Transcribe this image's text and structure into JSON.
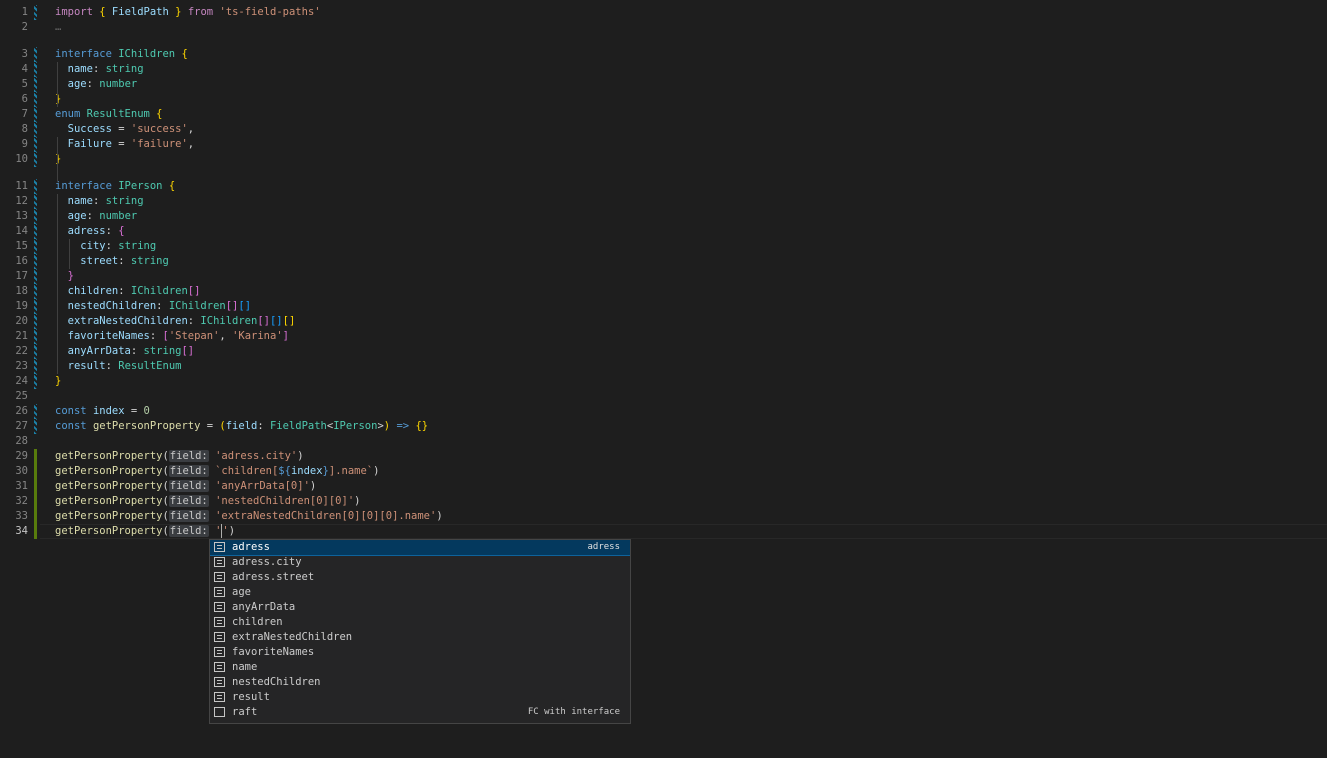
{
  "editor": {
    "active_line": "34",
    "lines": [
      {
        "n": "1",
        "segments": [
          [
            "kw2",
            "import"
          ],
          [
            "pu",
            " "
          ],
          [
            "br1",
            "{"
          ],
          [
            "pu",
            " "
          ],
          [
            "prop",
            "FieldPath"
          ],
          [
            "pu",
            " "
          ],
          [
            "br1",
            "}"
          ],
          [
            "pu",
            " "
          ],
          [
            "kw2",
            "from"
          ],
          [
            "pu",
            " "
          ],
          [
            "str",
            "'ts-field-paths'"
          ]
        ]
      },
      {
        "n": "2",
        "segments": [
          [
            "fold-dots",
            "…"
          ]
        ]
      },
      {
        "n": "3",
        "segments": [
          [
            "kw",
            "interface"
          ],
          [
            "pu",
            " "
          ],
          [
            "ty",
            "IChildren"
          ],
          [
            "pu",
            " "
          ],
          [
            "br1",
            "{"
          ]
        ]
      },
      {
        "n": "4",
        "segments": [
          [
            "pu",
            "  "
          ],
          [
            "prop",
            "name"
          ],
          [
            "pu",
            ": "
          ],
          [
            "ty",
            "string"
          ]
        ]
      },
      {
        "n": "5",
        "segments": [
          [
            "pu",
            "  "
          ],
          [
            "prop",
            "age"
          ],
          [
            "pu",
            ": "
          ],
          [
            "ty",
            "number"
          ]
        ]
      },
      {
        "n": "6",
        "segments": [
          [
            "br1",
            "}"
          ]
        ]
      },
      {
        "n": "7",
        "segments": [
          [
            "kw",
            "enum"
          ],
          [
            "pu",
            " "
          ],
          [
            "ty",
            "ResultEnum"
          ],
          [
            "pu",
            " "
          ],
          [
            "br1",
            "{"
          ]
        ]
      },
      {
        "n": "8",
        "segments": [
          [
            "pu",
            "  "
          ],
          [
            "prop",
            "Success"
          ],
          [
            "pu",
            " = "
          ],
          [
            "str",
            "'success'"
          ],
          [
            "pu",
            ","
          ]
        ]
      },
      {
        "n": "9",
        "segments": [
          [
            "pu",
            "  "
          ],
          [
            "prop",
            "Failure"
          ],
          [
            "pu",
            " = "
          ],
          [
            "str",
            "'failure'"
          ],
          [
            "pu",
            ","
          ]
        ]
      },
      {
        "n": "10",
        "segments": [
          [
            "br1",
            "}"
          ]
        ]
      },
      {
        "n": "11",
        "segments": [
          [
            "kw",
            "interface"
          ],
          [
            "pu",
            " "
          ],
          [
            "ty",
            "IPerson"
          ],
          [
            "pu",
            " "
          ],
          [
            "br1",
            "{"
          ]
        ]
      },
      {
        "n": "12",
        "segments": [
          [
            "pu",
            "  "
          ],
          [
            "prop",
            "name"
          ],
          [
            "pu",
            ": "
          ],
          [
            "ty",
            "string"
          ]
        ]
      },
      {
        "n": "13",
        "segments": [
          [
            "pu",
            "  "
          ],
          [
            "prop",
            "age"
          ],
          [
            "pu",
            ": "
          ],
          [
            "ty",
            "number"
          ]
        ]
      },
      {
        "n": "14",
        "segments": [
          [
            "pu",
            "  "
          ],
          [
            "prop",
            "adress"
          ],
          [
            "pu",
            ": "
          ],
          [
            "br2",
            "{"
          ]
        ]
      },
      {
        "n": "15",
        "segments": [
          [
            "pu",
            "    "
          ],
          [
            "prop",
            "city"
          ],
          [
            "pu",
            ": "
          ],
          [
            "ty",
            "string"
          ]
        ]
      },
      {
        "n": "16",
        "segments": [
          [
            "pu",
            "    "
          ],
          [
            "prop",
            "street"
          ],
          [
            "pu",
            ": "
          ],
          [
            "ty",
            "string"
          ]
        ]
      },
      {
        "n": "17",
        "segments": [
          [
            "pu",
            "  "
          ],
          [
            "br2",
            "}"
          ]
        ]
      },
      {
        "n": "18",
        "segments": [
          [
            "pu",
            "  "
          ],
          [
            "prop",
            "children"
          ],
          [
            "pu",
            ": "
          ],
          [
            "ty",
            "IChildren"
          ],
          [
            "br2",
            "[]"
          ]
        ]
      },
      {
        "n": "19",
        "segments": [
          [
            "pu",
            "  "
          ],
          [
            "prop",
            "nestedChildren"
          ],
          [
            "pu",
            ": "
          ],
          [
            "ty",
            "IChildren"
          ],
          [
            "br2",
            "[]"
          ],
          [
            "br3",
            "[]"
          ]
        ]
      },
      {
        "n": "20",
        "segments": [
          [
            "pu",
            "  "
          ],
          [
            "prop",
            "extraNestedChildren"
          ],
          [
            "pu",
            ": "
          ],
          [
            "ty",
            "IChildren"
          ],
          [
            "br2",
            "[]"
          ],
          [
            "br3",
            "[]"
          ],
          [
            "br1",
            "[]"
          ]
        ]
      },
      {
        "n": "21",
        "segments": [
          [
            "pu",
            "  "
          ],
          [
            "prop",
            "favoriteNames"
          ],
          [
            "pu",
            ": "
          ],
          [
            "br2",
            "["
          ],
          [
            "str",
            "'Stepan'"
          ],
          [
            "pu",
            ", "
          ],
          [
            "str",
            "'Karina'"
          ],
          [
            "br2",
            "]"
          ]
        ]
      },
      {
        "n": "22",
        "segments": [
          [
            "pu",
            "  "
          ],
          [
            "prop",
            "anyArrData"
          ],
          [
            "pu",
            ": "
          ],
          [
            "ty",
            "string"
          ],
          [
            "br2",
            "[]"
          ]
        ]
      },
      {
        "n": "23",
        "segments": [
          [
            "pu",
            "  "
          ],
          [
            "prop",
            "result"
          ],
          [
            "pu",
            ": "
          ],
          [
            "ty",
            "ResultEnum"
          ]
        ]
      },
      {
        "n": "24",
        "segments": [
          [
            "br1",
            "}"
          ]
        ]
      },
      {
        "n": "25",
        "segments": []
      },
      {
        "n": "26",
        "segments": [
          [
            "kw",
            "const"
          ],
          [
            "pu",
            " "
          ],
          [
            "prop",
            "index"
          ],
          [
            "pu",
            " = "
          ],
          [
            "num",
            "0"
          ]
        ]
      },
      {
        "n": "27",
        "segments": [
          [
            "kw",
            "const"
          ],
          [
            "pu",
            " "
          ],
          [
            "fn",
            "getPersonProperty"
          ],
          [
            "pu",
            " = "
          ],
          [
            "br1",
            "("
          ],
          [
            "prop",
            "field"
          ],
          [
            "pu",
            ": "
          ],
          [
            "ty",
            "FieldPath"
          ],
          [
            "pu",
            "<"
          ],
          [
            "ty",
            "IPerson"
          ],
          [
            "pu",
            ">"
          ],
          [
            "br1",
            ")"
          ],
          [
            "pu",
            " "
          ],
          [
            "kw",
            "=>"
          ],
          [
            "pu",
            " "
          ],
          [
            "br1",
            "{}"
          ]
        ]
      },
      {
        "n": "28",
        "segments": []
      },
      {
        "n": "29",
        "segments": [
          [
            "fn",
            "getPersonProperty"
          ],
          [
            "pu",
            "("
          ],
          [
            "hint",
            "field:"
          ],
          [
            "pu",
            " "
          ],
          [
            "str",
            "'adress.city'"
          ],
          [
            "pu",
            ")"
          ]
        ]
      },
      {
        "n": "30",
        "segments": [
          [
            "fn",
            "getPersonProperty"
          ],
          [
            "pu",
            "("
          ],
          [
            "hint",
            "field:"
          ],
          [
            "pu",
            " "
          ],
          [
            "str",
            "`children["
          ],
          [
            "kw",
            "${"
          ],
          [
            "prop",
            "index"
          ],
          [
            "kw",
            "}"
          ],
          [
            "str",
            "].name`"
          ],
          [
            "pu",
            ")"
          ]
        ]
      },
      {
        "n": "31",
        "segments": [
          [
            "fn",
            "getPersonProperty"
          ],
          [
            "pu",
            "("
          ],
          [
            "hint",
            "field:"
          ],
          [
            "pu",
            " "
          ],
          [
            "str",
            "'anyArrData[0]'"
          ],
          [
            "pu",
            ")"
          ]
        ]
      },
      {
        "n": "32",
        "segments": [
          [
            "fn",
            "getPersonProperty"
          ],
          [
            "pu",
            "("
          ],
          [
            "hint",
            "field:"
          ],
          [
            "pu",
            " "
          ],
          [
            "str",
            "'nestedChildren[0][0]'"
          ],
          [
            "pu",
            ")"
          ]
        ]
      },
      {
        "n": "33",
        "segments": [
          [
            "fn",
            "getPersonProperty"
          ],
          [
            "pu",
            "("
          ],
          [
            "hint",
            "field:"
          ],
          [
            "pu",
            " "
          ],
          [
            "str",
            "'extraNestedChildren[0][0][0].name'"
          ],
          [
            "pu",
            ")"
          ]
        ]
      },
      {
        "n": "34",
        "segments": [
          [
            "fn",
            "getPersonProperty"
          ],
          [
            "pu",
            "("
          ],
          [
            "hint",
            "field:"
          ],
          [
            "pu",
            " "
          ],
          [
            "str",
            "'"
          ],
          [
            "caret",
            ""
          ],
          [
            "str",
            "'"
          ],
          [
            "pu",
            ")"
          ]
        ]
      }
    ]
  },
  "suggest": {
    "items": [
      {
        "label": "adress",
        "detail": "adress",
        "icon": "field-icon",
        "selected": true
      },
      {
        "label": "adress.city",
        "detail": "",
        "icon": "field-icon",
        "selected": false
      },
      {
        "label": "adress.street",
        "detail": "",
        "icon": "field-icon",
        "selected": false
      },
      {
        "label": "age",
        "detail": "",
        "icon": "field-icon",
        "selected": false
      },
      {
        "label": "anyArrData",
        "detail": "",
        "icon": "field-icon",
        "selected": false
      },
      {
        "label": "children",
        "detail": "",
        "icon": "field-icon",
        "selected": false
      },
      {
        "label": "extraNestedChildren",
        "detail": "",
        "icon": "field-icon",
        "selected": false
      },
      {
        "label": "favoriteNames",
        "detail": "",
        "icon": "field-icon",
        "selected": false
      },
      {
        "label": "name",
        "detail": "",
        "icon": "field-icon",
        "selected": false
      },
      {
        "label": "nestedChildren",
        "detail": "",
        "icon": "field-icon",
        "selected": false
      },
      {
        "label": "result",
        "detail": "",
        "icon": "field-icon",
        "selected": false
      },
      {
        "label": "raft",
        "detail": "FC with interface",
        "icon": "snippet-icon",
        "selected": false
      }
    ]
  },
  "colors": {
    "background": "#1e1e1e",
    "modified_marker": "#1b81a8",
    "added_marker": "#587c0c",
    "suggest_selected": "#04395e"
  }
}
